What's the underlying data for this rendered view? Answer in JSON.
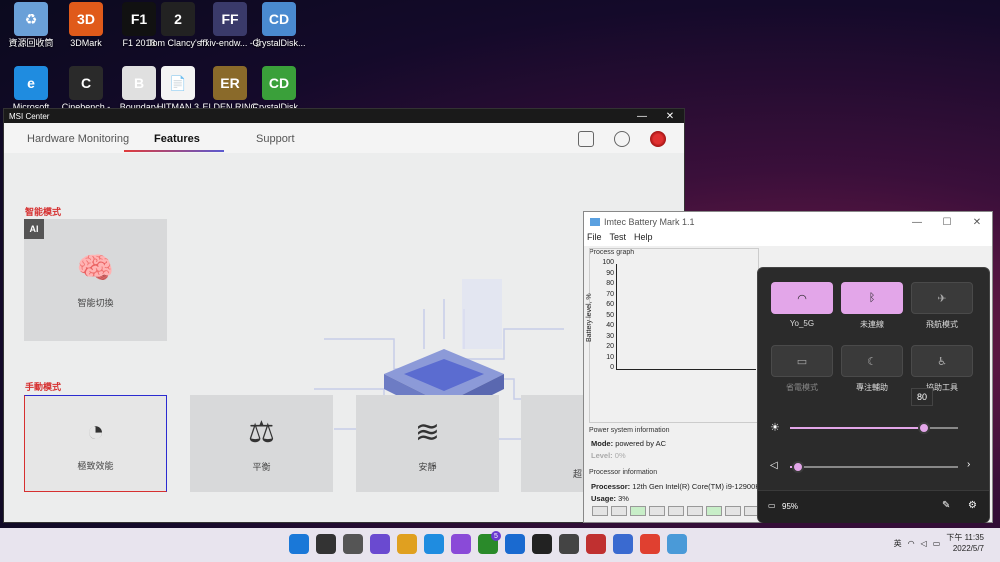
{
  "desktop": {
    "icons_row1": [
      {
        "label": "資源回收筒",
        "color": "#6aa0d8",
        "glyph": "♻"
      },
      {
        "label": "3DMark",
        "color": "#e05a1a",
        "glyph": "3D"
      },
      {
        "label": "F1 2018",
        "color": "#111111",
        "glyph": "F1"
      },
      {
        "label": "Tom Clancy's The Divisio...",
        "color": "#222222",
        "glyph": "2"
      },
      {
        "label": "ffxiv-endw... - 捷徑",
        "color": "#3a3a6a",
        "glyph": "FF"
      },
      {
        "label": "CrystalDisk...",
        "color": "#4a8ad0",
        "glyph": "CD"
      }
    ],
    "icons_row2": [
      {
        "label": "Microsoft",
        "color": "#1f8ce0",
        "glyph": "e"
      },
      {
        "label": "Cinebench -",
        "color": "#2a2a2a",
        "glyph": "C"
      },
      {
        "label": "Boundary",
        "color": "#e0e0e0",
        "glyph": "B"
      },
      {
        "label": "HITMAN 3",
        "color": "#f4f4f4",
        "glyph": "📄"
      },
      {
        "label": "ELDEN RING",
        "color": "#8a6a2a",
        "glyph": "ER"
      },
      {
        "label": "CrystalDisk...",
        "color": "#3aa03a",
        "glyph": "CD"
      }
    ]
  },
  "msi": {
    "window_title": "MSI Center",
    "tabs": [
      "Hardware Monitoring",
      "Features",
      "Support"
    ],
    "smart_section": "智能模式",
    "ai_badge": "AI",
    "ai_card_label": "智能切換",
    "manual_section": "手動模式",
    "manual_cards": [
      "極致效能",
      "平衡",
      "安靜",
      "超"
    ]
  },
  "battery_mark": {
    "title": "Imtec Battery Mark 1.1",
    "menu": [
      "File",
      "Test",
      "Help"
    ],
    "process_graph": "Process graph",
    "y_axis_label": "Battery level, %",
    "y_ticks": [
      "100",
      "90",
      "80",
      "70",
      "60",
      "50",
      "40",
      "30",
      "20",
      "10",
      "0"
    ],
    "power_group": "Power system information",
    "mode_key": "Mode:",
    "mode_value": "powered by AC",
    "level_key": "Level:",
    "level_value": "0%",
    "processor_group": "Processor information",
    "processor_key": "Processor:",
    "processor_value": "12th Gen Intel(R) Core(TM) i9-12900HK",
    "usage_key": "Usage:",
    "usage_value": "3%"
  },
  "quick_settings": {
    "tiles": [
      {
        "label": "Yo_5G",
        "icon": "wifi-icon",
        "on": true
      },
      {
        "label": "未連線",
        "icon": "bluetooth-icon",
        "on": true
      },
      {
        "label": "飛航模式",
        "icon": "airplane-icon",
        "on": false
      },
      {
        "label": "省電模式",
        "icon": "battery-saver-icon",
        "on": false
      },
      {
        "label": "專注輔助",
        "icon": "moon-icon",
        "on": false
      },
      {
        "label": "協助工具",
        "icon": "accessibility-icon",
        "on": false
      }
    ],
    "brightness_tooltip": "80",
    "brightness_value": 80,
    "volume_value": 3,
    "battery_text": "95%"
  },
  "taskbar": {
    "ime": "英",
    "time": "下午 11:35",
    "date": "2022/5/7",
    "badge": "5"
  }
}
